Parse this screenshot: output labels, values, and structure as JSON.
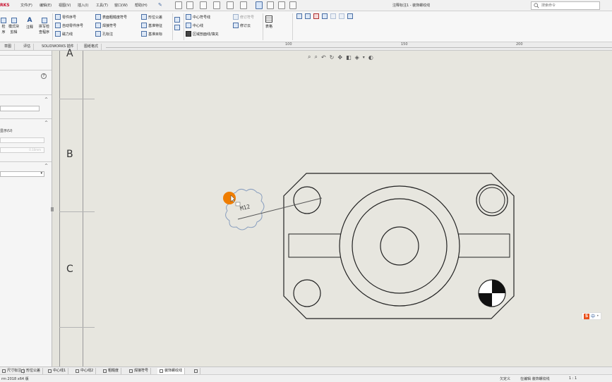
{
  "app": {
    "brand": "RKS",
    "document_title": "注释标注1 - 装饰螺纹线"
  },
  "menu": [
    "文件(F)",
    "编辑(E)",
    "视图(V)",
    "插入(I)",
    "工具(T)",
    "窗口(W)",
    "帮助(H)"
  ],
  "search": {
    "placeholder": "搜索命令"
  },
  "ribbon": {
    "col1": [
      "检",
      "序"
    ],
    "col2": [
      "模式块",
      "剪辑"
    ],
    "col3": "注释",
    "col4": [
      "拼写检",
      "查程序"
    ],
    "group_a": [
      "零件序号",
      "自动零件序号",
      "磁力线"
    ],
    "group_b": [
      "表面粗糙度符号",
      "焊接符号",
      "孔标注"
    ],
    "group_c": [
      "形位公差",
      "基准特征",
      "基准目标"
    ],
    "group_d": [
      "中心符号线",
      "中心线",
      "区域剖面线/填充"
    ],
    "group_e": [
      "修订符号",
      "修订云"
    ],
    "table_label": "表格"
  },
  "command_tabs": [
    "草图",
    "评估",
    "SOLIDWORKS 插件",
    "图纸格式"
  ],
  "ruler": [
    "100",
    "150",
    "200"
  ],
  "zone_labels": [
    "A",
    "B",
    "C"
  ],
  "annotation": {
    "text": "M12"
  },
  "left_panel": {
    "option_label": "显示(U)",
    "value_text": "0.10mm"
  },
  "ime": "中",
  "bottom_tabs": [
    "尺寸标注",
    "形位公差",
    "中心线1",
    "中心线2",
    "粗糙度",
    "焊接符号",
    "装饰螺纹线"
  ],
  "status": {
    "left": "rm 2018 x64 版",
    "state": "欠定义",
    "editing": "在编辑 装饰螺纹线",
    "scale": "1 : 1"
  },
  "colors": {
    "cursor_highlight": "#ef7d00",
    "brand": "#c8102e",
    "sheet_bg": "#e7e6df"
  }
}
